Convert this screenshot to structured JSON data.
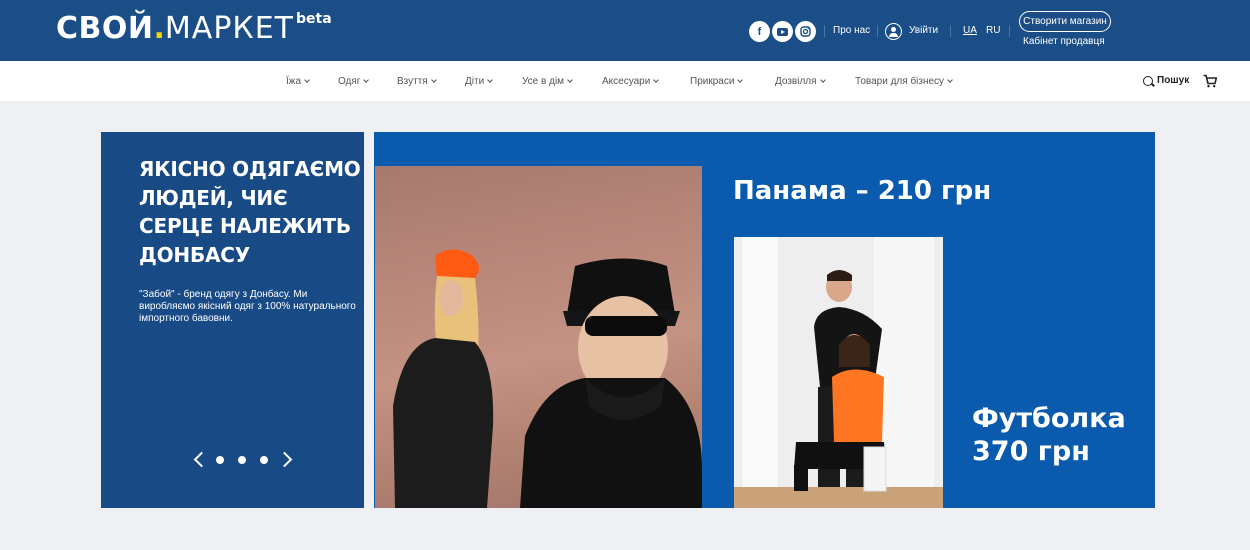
{
  "header": {
    "logo": {
      "bold": "СВОЙ",
      "dot": ".",
      "thin": "МАРКЕТ",
      "badge": "beta"
    },
    "social_icons": [
      "facebook-icon",
      "youtube-icon",
      "instagram-icon"
    ],
    "about_label": "Про нас",
    "login_label": "Увійти",
    "lang_ua": "UA",
    "lang_ru": "RU",
    "create_store_label": "Створити магазин",
    "seller_cabinet_label": "Кабінет продавця"
  },
  "nav": {
    "items": [
      {
        "label": "Їжа"
      },
      {
        "label": "Одяг"
      },
      {
        "label": "Взуття"
      },
      {
        "label": "Діти"
      },
      {
        "label": "Усе в дім"
      },
      {
        "label": "Аксесуари"
      },
      {
        "label": "Прикраси"
      },
      {
        "label": "Дозвілля"
      },
      {
        "label": "Товари для бізнесу"
      }
    ],
    "search_label": "Пошук",
    "cart_icon": "cart-icon"
  },
  "hero": {
    "title": "ЯКІСНО ОДЯГАЄМО ЛЮДЕЙ, ЧИЄ СЕРЦЕ НАЛЕЖИТЬ ДОНБАСУ",
    "description": "\"Забой\" - бренд одягу з Донбасу. Ми виробляємо якісний одяг з 100% натурального імпортного бавовни.",
    "slide_count": 3,
    "price_panama": "Панама – 210 грн",
    "price_tshirt": "Футболка 370 грн"
  },
  "colors": {
    "header_bg": "#1b4e86",
    "hero_left_bg": "#184a86",
    "hero_right_bg": "#0a5aad",
    "accent_yellow": "#f2d600"
  }
}
